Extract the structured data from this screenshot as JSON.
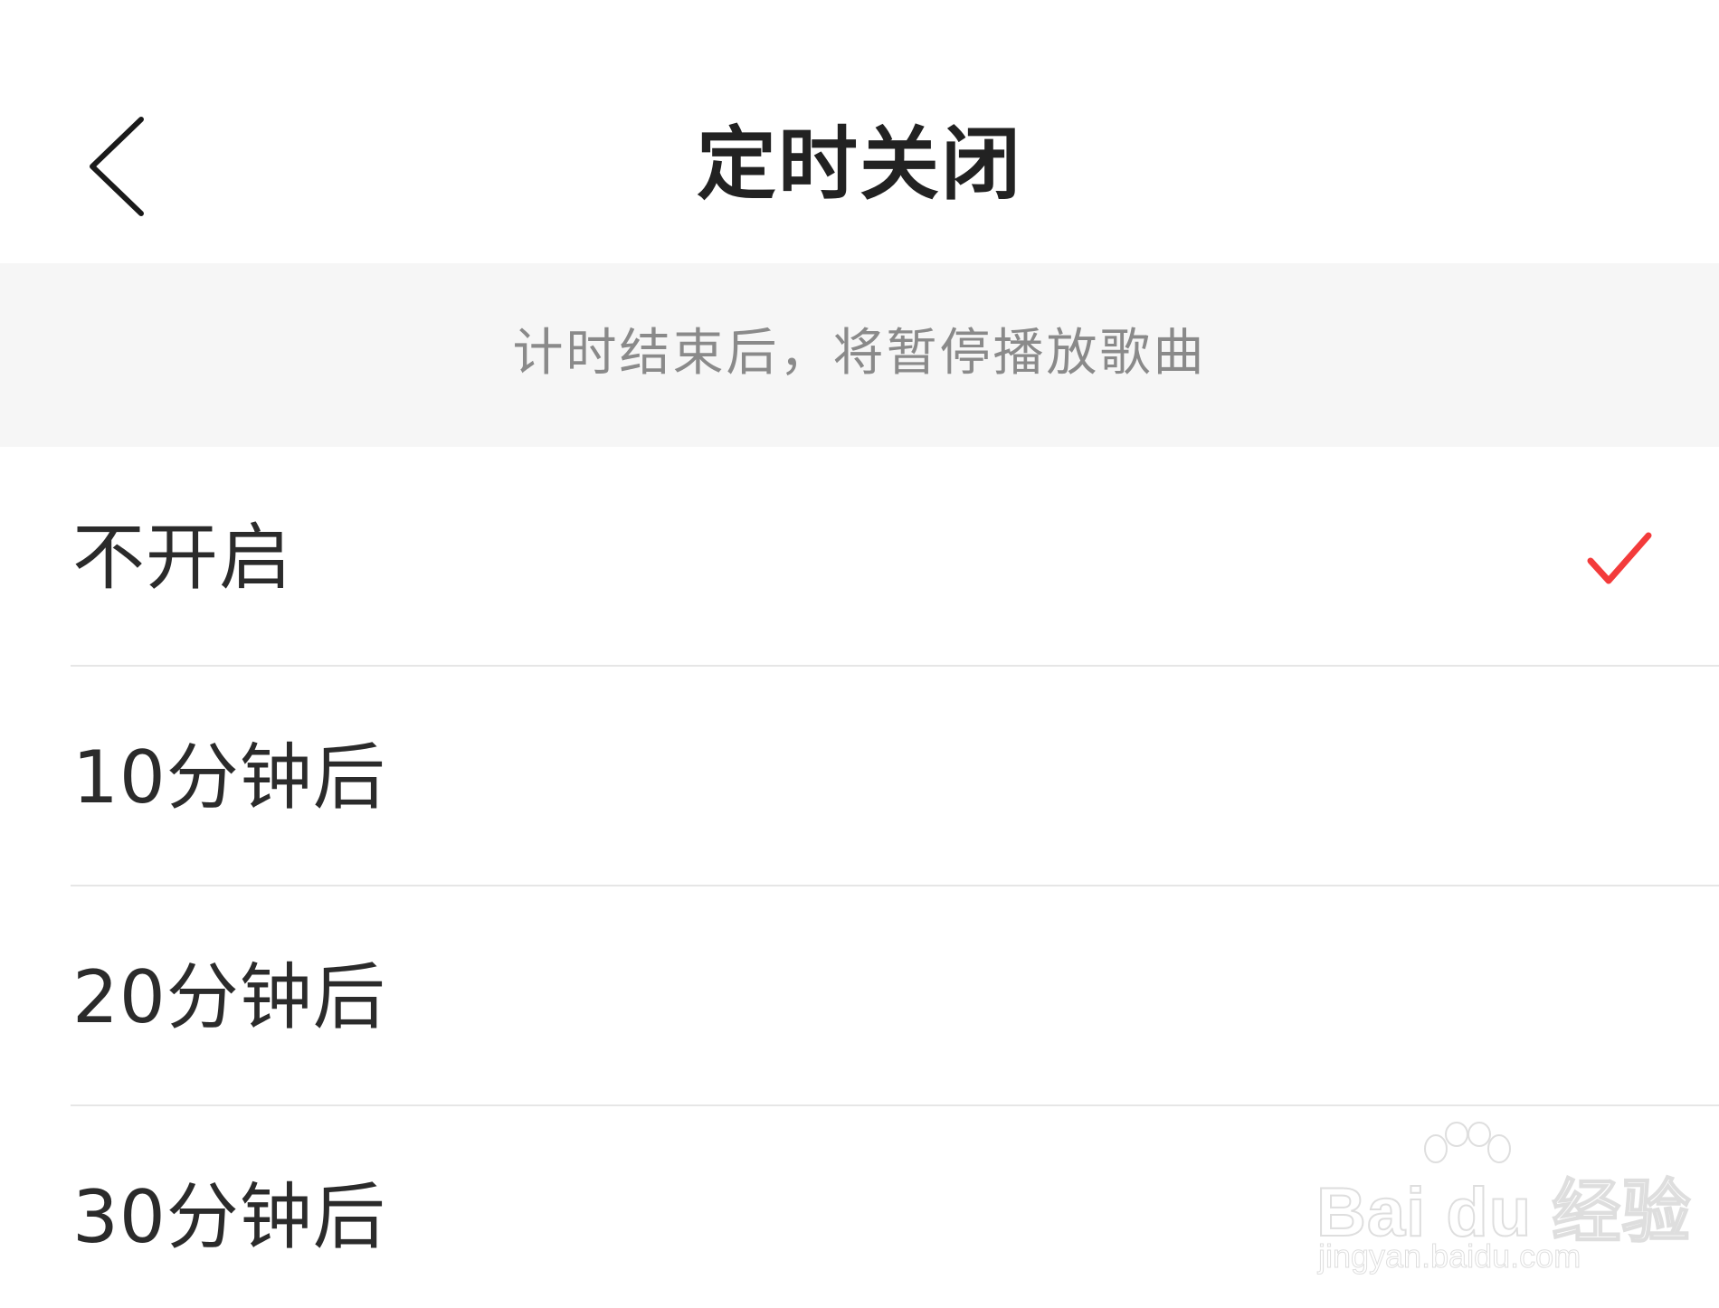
{
  "header": {
    "title": "定时关闭",
    "back_icon": "chevron-left-icon"
  },
  "hint": {
    "text": "计时结束后，将暂停播放歌曲"
  },
  "options": [
    {
      "label": "不开启",
      "selected": true
    },
    {
      "label": "10分钟后",
      "selected": false
    },
    {
      "label": "20分钟后",
      "selected": false
    },
    {
      "label": "30分钟后",
      "selected": false
    }
  ],
  "watermark": {
    "logo": "Bai du 经验",
    "url": "jingyan.baidu.com"
  },
  "colors": {
    "accent": "#f33b3b",
    "title_text": "#222222",
    "hint_text": "#8a8a8a",
    "hint_background": "#f6f6f6",
    "divider": "#e6e6e6"
  }
}
